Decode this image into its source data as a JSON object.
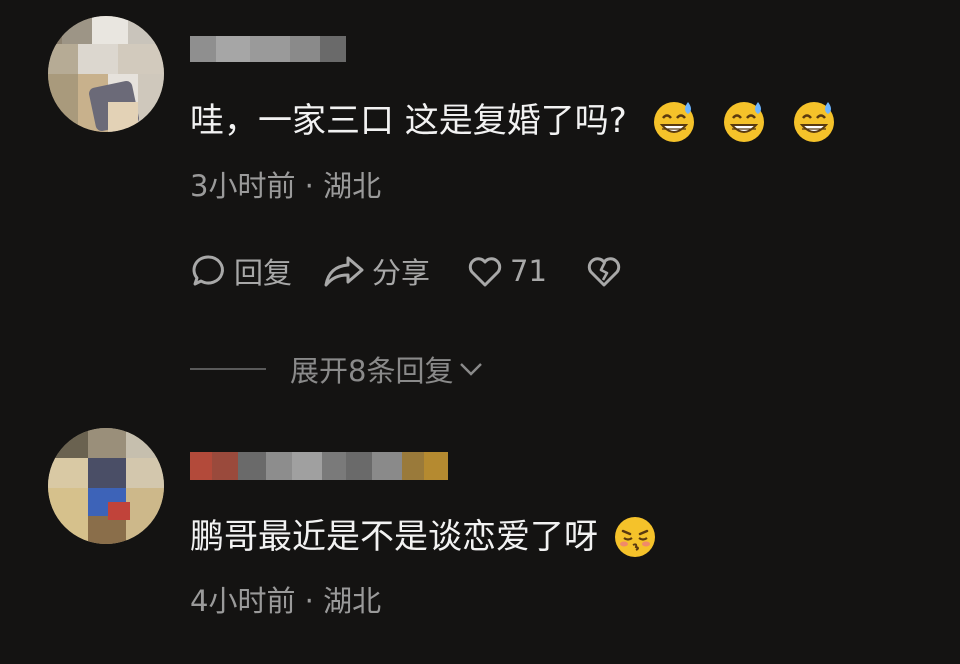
{
  "comments": [
    {
      "text": "哇，一家三口 这是复婚了吗?",
      "emojis": [
        "grinning-sweat-emoji",
        "grinning-sweat-emoji",
        "grinning-sweat-emoji"
      ],
      "meta": "3小时前 · 湖北",
      "actions": {
        "reply_label": "回复",
        "share_label": "分享",
        "like_count": "71"
      },
      "expand_label": "展开8条回复"
    },
    {
      "text": "鹏哥最近是不是谈恋爱了呀",
      "emojis": [
        "kissing-emoji"
      ],
      "meta": "4小时前 · 湖北"
    }
  ],
  "colors": {
    "background": "#141312",
    "text_primary": "#f2f2f2",
    "text_secondary": "#9a9a9a",
    "emoji_yellow": "#f5c22a"
  }
}
